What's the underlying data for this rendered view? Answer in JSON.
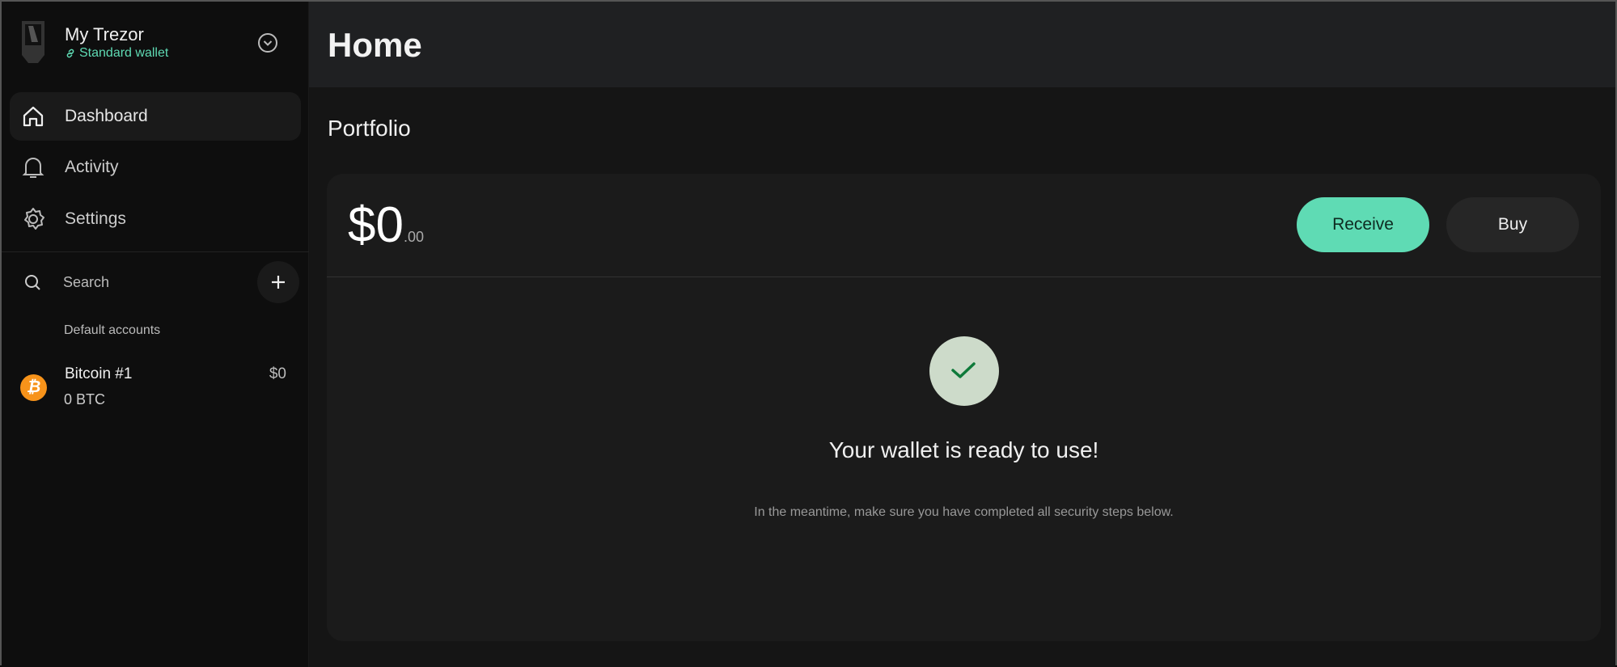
{
  "device": {
    "name": "My Trezor",
    "wallet_type": "Standard wallet"
  },
  "nav": [
    {
      "label": "Dashboard",
      "icon": "home-icon",
      "active": true
    },
    {
      "label": "Activity",
      "icon": "bell-icon"
    },
    {
      "label": "Settings",
      "icon": "gear-icon"
    }
  ],
  "search": {
    "placeholder": "Search"
  },
  "accounts": {
    "group_label": "Default accounts",
    "items": [
      {
        "name": "Bitcoin #1",
        "balance": "0 BTC",
        "fiat": "$0",
        "icon": "bitcoin-icon"
      }
    ]
  },
  "header": {
    "title": "Home"
  },
  "portfolio": {
    "heading": "Portfolio",
    "balance_main": "$0",
    "balance_decimals": ".00",
    "receive_label": "Receive",
    "buy_label": "Buy"
  },
  "empty_state": {
    "title": "Your wallet is ready to use!",
    "subtitle": "In the meantime, make sure you have completed all security steps below."
  },
  "colors": {
    "accent": "#5fdbb4",
    "success_icon": "#0e7a3a",
    "success_bg": "#cddbca",
    "bitcoin": "#f7931a"
  }
}
